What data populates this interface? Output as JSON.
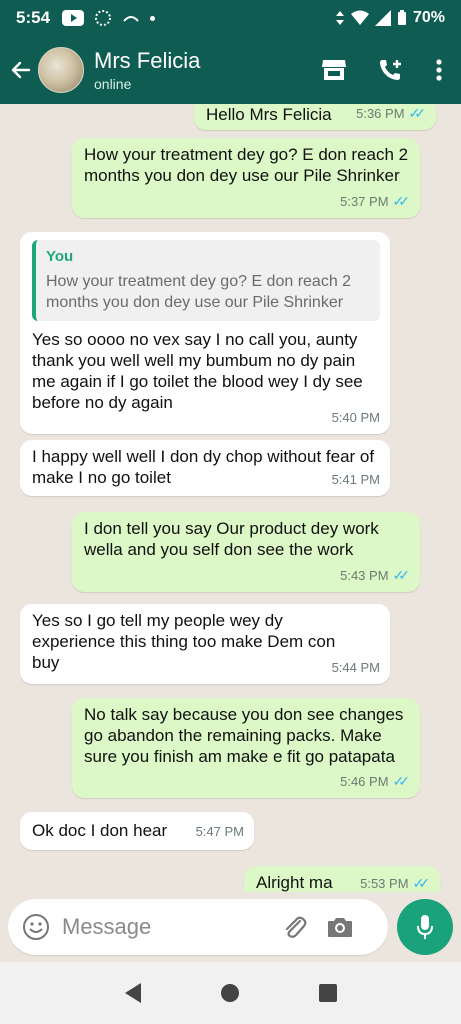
{
  "status_bar": {
    "time": "5:54",
    "battery": "70%"
  },
  "header": {
    "contact_name": "Mrs Felicia",
    "contact_status": "online"
  },
  "messages": [
    {
      "dir": "out",
      "text": "Hello Mrs Felicia",
      "time": "5:36 PM",
      "ticks": "✓✓"
    },
    {
      "dir": "out",
      "text": "How your treatment dey go? E don reach 2 months you don dey use our Pile Shrinker",
      "time": "5:37 PM",
      "ticks": "✓✓"
    },
    {
      "dir": "in",
      "quote_author": "You",
      "quote_text": "How your treatment dey go? E don reach 2 months you don dey use our Pile Shrinker",
      "text": "Yes so oooo no vex say I no call you, aunty thank you well well my bumbum no dy pain me again if I go toilet the blood wey I dy see before no dy again",
      "time": "5:40 PM"
    },
    {
      "dir": "in",
      "text": "I happy well well I don dy chop without fear of make I no go toilet",
      "time": "5:41 PM"
    },
    {
      "dir": "out",
      "text": "I don tell you say Our product dey work wella and you self don see the work",
      "time": "5:43 PM",
      "ticks": "✓✓"
    },
    {
      "dir": "in",
      "text": "Yes so I go tell my people wey dy experience this thing too make Dem con buy",
      "time": "5:44 PM"
    },
    {
      "dir": "out",
      "text": "No talk say because you don see changes go abandon the remaining packs. Make sure you finish am make e fit go patapata",
      "time": "5:46 PM",
      "ticks": "✓✓"
    },
    {
      "dir": "in",
      "text": "Ok doc I don hear",
      "time": "5:47 PM"
    },
    {
      "dir": "out",
      "text": "Alright ma",
      "time": "5:53 PM",
      "ticks": "✓✓"
    }
  ],
  "composer": {
    "placeholder": "Message"
  },
  "colors": {
    "header": "#0f5c52",
    "outgoing": "#dcf8c6",
    "incoming": "#ffffff",
    "accent": "#1aa37a",
    "tick": "#34b7f1"
  },
  "icons": [
    "back-arrow-icon",
    "store-icon",
    "add-call-icon",
    "more-vert-icon",
    "emoji-icon",
    "attach-icon",
    "camera-icon",
    "mic-icon"
  ]
}
